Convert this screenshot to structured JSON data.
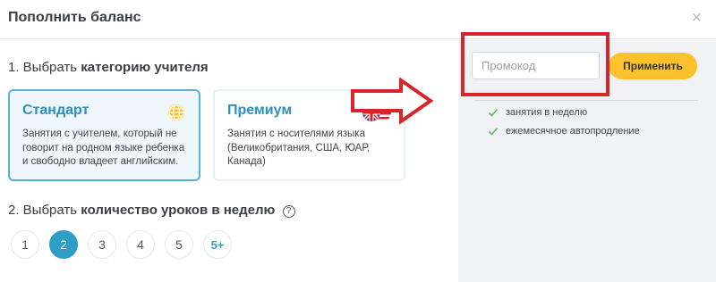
{
  "header": {
    "title": "Пополнить баланс",
    "close": "×"
  },
  "step1": {
    "prefix": "1. Выбрать",
    "bold": "категорию учителя"
  },
  "cards": [
    {
      "title": "Стандарт",
      "desc": "Занятия с учителем, который не говорит на родном языке ребенка и свободно владеет английским.",
      "icon": "globe-icon"
    },
    {
      "title": "Премиум",
      "desc": "Занятия с носителями языка (Великобритания, США, ЮАР, Канада)",
      "icon": "uk-us-flags-icon"
    }
  ],
  "step2": {
    "prefix": "2. Выбрать",
    "bold": "количество уроков в неделю",
    "help": "?"
  },
  "lessons": {
    "options": [
      "1",
      "2",
      "3",
      "4",
      "5",
      "5+"
    ],
    "selected": "2"
  },
  "promo": {
    "placeholder": "Промокод",
    "value": "",
    "apply_label": "Применить"
  },
  "features": [
    "занятия в неделю",
    "ежемесячное автопродление"
  ],
  "colors": {
    "accent": "#2f9ec7",
    "button": "#fdc12e",
    "annotation": "#d8252a",
    "check": "#5cb85c"
  }
}
